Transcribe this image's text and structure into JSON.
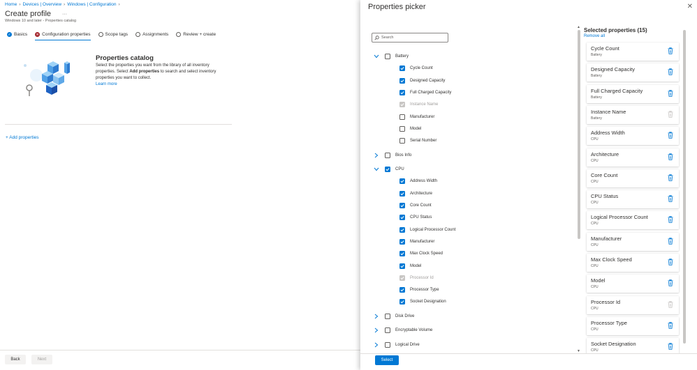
{
  "breadcrumb": [
    "Home",
    "Devices | Overview",
    "Windows | Configuration"
  ],
  "page": {
    "title": "Create profile",
    "subtitle": "Windows 10 and later - Properties catalog"
  },
  "steps": [
    {
      "label": "Basics",
      "state": "done"
    },
    {
      "label": "Configuration properties",
      "state": "error"
    },
    {
      "label": "Scope tags",
      "state": "todo"
    },
    {
      "label": "Assignments",
      "state": "todo"
    },
    {
      "label": "Review + create",
      "state": "todo"
    }
  ],
  "catalog": {
    "title": "Properties catalog",
    "desc_1": "Select the properties you want from the library of all inventory properties. Select ",
    "desc_bold": "Add properties",
    "desc_2": " to search and select inventory properties you want to collect.",
    "learn_more": "Learn more",
    "add_properties": "+ Add properties"
  },
  "footer": {
    "back": "Back",
    "next": "Next"
  },
  "panel": {
    "title": "Properties picker",
    "search_placeholder": "Search",
    "select_button": "Select",
    "selected_header": "Selected properties (15)",
    "remove_all": "Remove all"
  },
  "tree": [
    {
      "label": "Battery",
      "level": 0,
      "expanded": true,
      "state": "unchecked"
    },
    {
      "label": "Cycle Count",
      "level": 1,
      "state": "checked"
    },
    {
      "label": "Designed Capacity",
      "level": 1,
      "state": "checked"
    },
    {
      "label": "Full Charged Capacity",
      "level": 1,
      "state": "checked"
    },
    {
      "label": "Instance Name",
      "level": 1,
      "state": "disabled"
    },
    {
      "label": "Manufacturer",
      "level": 1,
      "state": "unchecked"
    },
    {
      "label": "Model",
      "level": 1,
      "state": "unchecked"
    },
    {
      "label": "Serial Number",
      "level": 1,
      "state": "unchecked"
    },
    {
      "label": "Bios Info",
      "level": 0,
      "expanded": false,
      "state": "unchecked"
    },
    {
      "label": "CPU",
      "level": 0,
      "expanded": true,
      "state": "checked"
    },
    {
      "label": "Address Width",
      "level": 1,
      "state": "checked"
    },
    {
      "label": "Architecture",
      "level": 1,
      "state": "checked"
    },
    {
      "label": "Core Count",
      "level": 1,
      "state": "checked"
    },
    {
      "label": "CPU Status",
      "level": 1,
      "state": "checked"
    },
    {
      "label": "Logical Processor Count",
      "level": 1,
      "state": "checked"
    },
    {
      "label": "Manufacturer",
      "level": 1,
      "state": "checked"
    },
    {
      "label": "Max Clock Speed",
      "level": 1,
      "state": "checked"
    },
    {
      "label": "Model",
      "level": 1,
      "state": "checked"
    },
    {
      "label": "Processor Id",
      "level": 1,
      "state": "disabled"
    },
    {
      "label": "Processor Type",
      "level": 1,
      "state": "checked"
    },
    {
      "label": "Socket Designation",
      "level": 1,
      "state": "checked"
    },
    {
      "label": "Disk Drive",
      "level": 0,
      "expanded": false,
      "state": "unchecked"
    },
    {
      "label": "Encryptable Volume",
      "level": 0,
      "expanded": false,
      "state": "unchecked"
    },
    {
      "label": "Logical Drive",
      "level": 0,
      "expanded": false,
      "state": "unchecked"
    }
  ],
  "selected": [
    {
      "name": "Cycle Count",
      "category": "Battery",
      "removable": true
    },
    {
      "name": "Designed Capacity",
      "category": "Battery",
      "removable": true
    },
    {
      "name": "Full Charged Capacity",
      "category": "Battery",
      "removable": true
    },
    {
      "name": "Instance Name",
      "category": "Battery",
      "removable": false
    },
    {
      "name": "Address Width",
      "category": "CPU",
      "removable": true
    },
    {
      "name": "Architecture",
      "category": "CPU",
      "removable": true
    },
    {
      "name": "Core Count",
      "category": "CPU",
      "removable": true
    },
    {
      "name": "CPU Status",
      "category": "CPU",
      "removable": true
    },
    {
      "name": "Logical Processor Count",
      "category": "CPU",
      "removable": true
    },
    {
      "name": "Manufacturer",
      "category": "CPU",
      "removable": true
    },
    {
      "name": "Max Clock Speed",
      "category": "CPU",
      "removable": true
    },
    {
      "name": "Model",
      "category": "CPU",
      "removable": true
    },
    {
      "name": "Processor Id",
      "category": "CPU",
      "removable": false
    },
    {
      "name": "Processor Type",
      "category": "CPU",
      "removable": true
    },
    {
      "name": "Socket Designation",
      "category": "CPU",
      "removable": true
    }
  ],
  "colors": {
    "accent": "#0078d4",
    "error": "#a4262c",
    "disabled": "#c8c6c4"
  }
}
